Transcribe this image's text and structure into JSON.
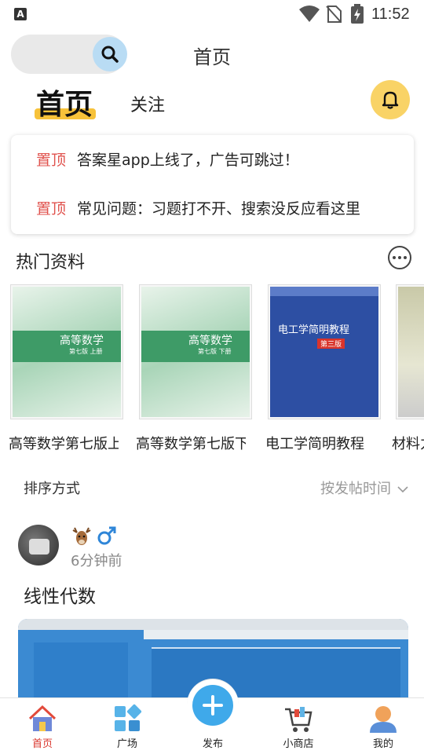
{
  "status_bar": {
    "time": "11:52"
  },
  "header": {
    "title": "首页"
  },
  "tabs": {
    "home": "首页",
    "follow": "关注"
  },
  "notices": [
    {
      "pin": "置顶",
      "text": "答案星app上线了，广告可跳过！"
    },
    {
      "pin": "置顶",
      "text": "常见问题：习题打不开、搜索没反应看这里"
    }
  ],
  "hot_section": {
    "title": "热门资料",
    "books": [
      {
        "title": "高等数学第七版上册",
        "cover_title": "高等数学",
        "cover_sub": "第七版 上册"
      },
      {
        "title": "高等数学第七版下册",
        "cover_title": "高等数学",
        "cover_sub": "第七版 下册"
      },
      {
        "title": "电工学简明教程",
        "cover_title": "电工学简明教程",
        "cover_sub": "第三版"
      },
      {
        "title": "材料力学"
      }
    ]
  },
  "sort": {
    "label": "排序方式",
    "value": "按发帖时间"
  },
  "post": {
    "time": "6分钟前",
    "title": "线性代数"
  },
  "bottom_nav": {
    "home": "首页",
    "square": "广场",
    "publish": "发布",
    "shop": "小商店",
    "mine": "我的"
  },
  "colors": {
    "accent_yellow": "#f7c23a",
    "pin_red": "#e0524d",
    "active_red": "#d9342b",
    "publish_blue": "#3fa9ea"
  }
}
